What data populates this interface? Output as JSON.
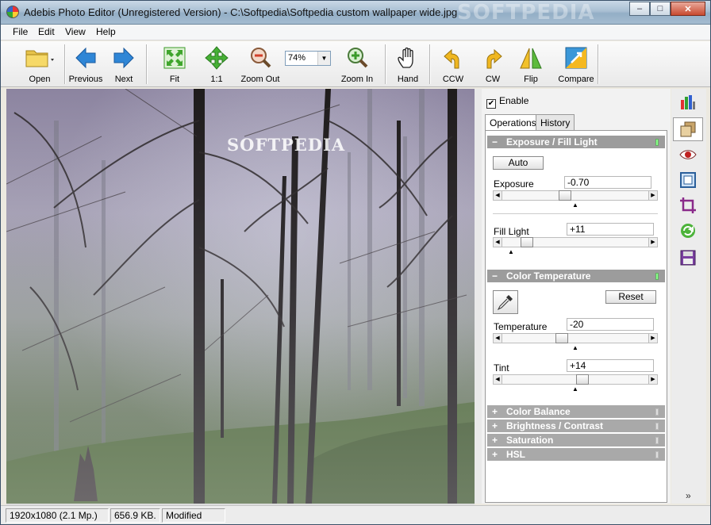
{
  "window": {
    "title": "Adebis Photo Editor (Unregistered Version) - C:\\Softpedia\\Softpedia custom wallpaper wide.jpg",
    "watermark": "SOFTPEDIA",
    "minimize": "–",
    "maximize": "□",
    "close": "✕"
  },
  "menu": [
    "File",
    "Edit",
    "View",
    "Help"
  ],
  "toolbar": {
    "open": "Open",
    "previous": "Previous",
    "next": "Next",
    "fit": "Fit",
    "one_to_one": "1:1",
    "zoom_out": "Zoom Out",
    "zoom_value": "74%",
    "zoom_in": "Zoom In",
    "hand": "Hand",
    "ccw": "CCW",
    "cw": "CW",
    "flip": "Flip",
    "compare": "Compare"
  },
  "image": {
    "overlay_text": "SOFTPEDIA"
  },
  "panel": {
    "enable_label": "Enable",
    "enable_checked": true,
    "tabs": [
      "Operations",
      "History"
    ],
    "exposure_fill": {
      "title": "Exposure / Fill Light",
      "auto": "Auto",
      "exposure_label": "Exposure",
      "exposure_value": "-0.70",
      "fill_label": "Fill Light",
      "fill_value": "+11"
    },
    "color_temp": {
      "title": "Color Temperature",
      "reset": "Reset",
      "temp_label": "Temperature",
      "temp_value": "-20",
      "tint_label": "Tint",
      "tint_value": "+14"
    },
    "collapsed": [
      "Color Balance",
      "Brightness / Contrast",
      "Saturation",
      "HSL"
    ],
    "sign_open": "−",
    "sign_closed": "+"
  },
  "sidebar": {
    "more": "»"
  },
  "status": {
    "dimensions": "1920x1080 (2.1 Mp.)",
    "size": "656.9 KB.",
    "state": "Modified"
  }
}
